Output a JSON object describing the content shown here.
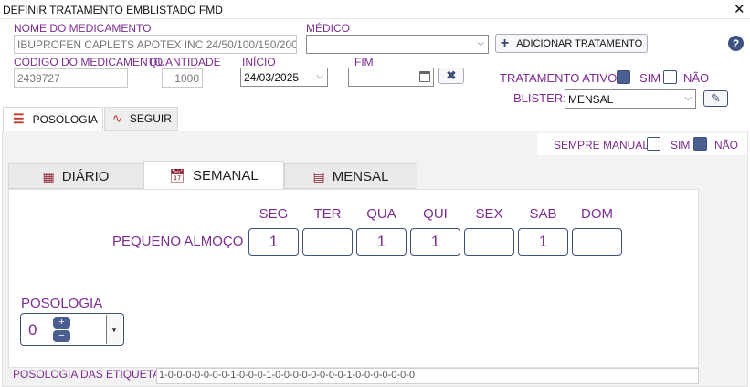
{
  "window": {
    "title": "DEFINIR TRATAMENTO EMBLISTADO FMD",
    "close_glyph": "✕"
  },
  "medication": {
    "label": "NOME DO MEDICAMENTO",
    "value": "IBUPROFEN CAPLETS APOTEX INC 24/50/100/150/200"
  },
  "doctor": {
    "label": "MÉDICO",
    "value": ""
  },
  "add_treatment": {
    "label": "ADICIONAR TRATAMENTO"
  },
  "help_glyph": "?",
  "code": {
    "label": "CÓDIGO DO MEDICAMENTO",
    "value": "2439727"
  },
  "quantity": {
    "label": "QUANTIDADE",
    "value": "1000"
  },
  "start": {
    "label": "INÍCIO",
    "value": "24/03/2025"
  },
  "end": {
    "label": "FIM",
    "value": ""
  },
  "active": {
    "label": "TRATAMENTO ATIVO",
    "yes": "SIM",
    "no": "NÃO",
    "yes_checked": true,
    "no_checked": false
  },
  "blister": {
    "label": "BLISTER:",
    "value": "MENSAL"
  },
  "main_tabs": [
    {
      "label": "POSOLOGIA",
      "icon": "list-icon",
      "active": true
    },
    {
      "label": "SEGUIR",
      "icon": "pulse-icon",
      "active": false
    }
  ],
  "always_manual": {
    "label": "SEMPRE MANUAL",
    "yes": "SIM",
    "no": "NÃO",
    "checkbox_checked": false,
    "yes_checked": true
  },
  "schedule_tabs": [
    {
      "label": "DIÁRIO",
      "icon": "grid-icon",
      "active": false
    },
    {
      "label": "SEMANAL",
      "icon": "calendar-icon",
      "active": true
    },
    {
      "label": "MENSAL",
      "icon": "month-icon",
      "active": false
    }
  ],
  "weekly": {
    "days": [
      "SEG",
      "TER",
      "QUA",
      "QUI",
      "SEX",
      "SAB",
      "DOM"
    ],
    "row_label": "PEQUENO ALMOÇO",
    "values": [
      "1",
      "",
      "1",
      "1",
      "",
      "1",
      ""
    ]
  },
  "posology": {
    "label": "POSOLOGIA",
    "value": "0",
    "plus": "+",
    "minus": "−"
  },
  "label_posology": {
    "label": "POSOLOGIA DAS ETIQUETA",
    "value": "1-0-0-0-0-0-0-0-1-0-0-0-1-0-0-0-0-0-0-0-0-1-0-0-0-0-0-0-0"
  },
  "colors": {
    "accent": "#7b2d8e",
    "checkbox_on": "#4a5f8f",
    "border_dark": "#3d4f7a"
  }
}
